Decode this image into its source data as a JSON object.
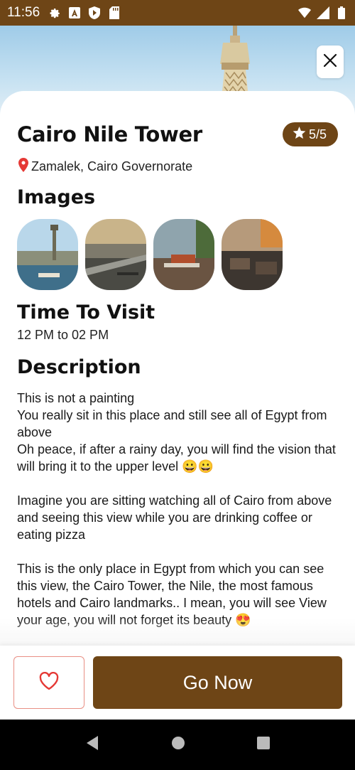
{
  "status_bar": {
    "time": "11:56",
    "background_color": "#6e4516",
    "left_icons": [
      "settings-icon",
      "a-letter-icon",
      "shield-icon",
      "sd-card-icon"
    ],
    "right_icons": [
      "wifi-icon",
      "signal-icon",
      "battery-icon"
    ]
  },
  "header": {
    "close_icon": "close-icon"
  },
  "place": {
    "title": "Cairo Nile Tower",
    "rating": "5/5",
    "location": "Zamalek, Cairo Governorate"
  },
  "images_section": {
    "heading": "Images",
    "thumbnails": [
      "Cairo tower over the Nile",
      "City view with balcony",
      "Terrace cafe tables",
      "Cafe seating with view"
    ]
  },
  "visit_section": {
    "heading": "Time To Visit",
    "hours": "12 PM to 02 PM"
  },
  "description_section": {
    "heading": "Description",
    "paragraphs": [
      "This is not a painting\nYou really sit in this place and still see all of Egypt from above\nOh peace, if after a rainy day, you will find the vision that will bring it to the upper level 😀😀",
      "Imagine you are sitting watching all of Cairo from above and seeing this view while you are drinking coffee or eating pizza",
      "This is the only place in Egypt from which you can see this view, the Cairo Tower, the Nile, the most famous hotels and Cairo landmarks.. I mean, you will see View your age, you will not forget its beauty 😍"
    ]
  },
  "actions": {
    "favorite_icon": "heart-outline-icon",
    "go_label": "Go Now"
  },
  "colors": {
    "brand": "#6e4516",
    "favorite_border": "#e98f84",
    "pin": "#e53935"
  },
  "nav_bar": {
    "icons": [
      "back-icon",
      "home-icon",
      "recents-icon"
    ]
  }
}
